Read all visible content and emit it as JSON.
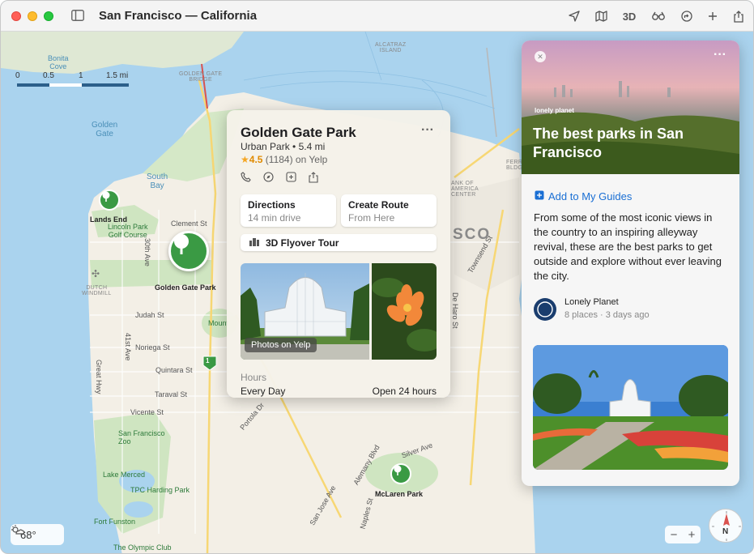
{
  "window": {
    "title": "San Francisco — California"
  },
  "toolbar": {
    "three_d_label": "3D"
  },
  "map": {
    "scale": {
      "labels": [
        "0",
        "0.5",
        "1",
        "1.5 mi"
      ]
    },
    "labels": {
      "bonita_cove": "Bonita\nCove",
      "golden_gate_bridge": "GOLDEN GATE\nBRIDGE",
      "alcatraz": "ALCATRAZ\nISLAND",
      "golden_gate_water": "Golden\nGate",
      "south_bay": "South\nBay",
      "lands_end": "Lands End",
      "lincoln_park": "Lincoln Park\nGolf Course",
      "clement_st": "Clement St",
      "thirtieth_ave": "30th Ave",
      "dutch_windmill": "DUTCH\nWINDMILL",
      "golden_gate_park": "Golden Gate Park",
      "judah_st": "Judah St",
      "noriega_st": "Noriega St",
      "quintara_st": "Quintara St",
      "taraval_st": "Taraval St",
      "vicente_st": "Vicente St",
      "great_hwy": "Great Hwy",
      "forty_first_ave": "41st Ave",
      "sf_zoo": "San Francisco\nZoo",
      "lake_merced": "Lake Merced",
      "tpc_harding": "TPC Harding Park",
      "fort_funston": "Fort Funston",
      "olympic_club": "The Olympic Club",
      "mcLaren_park": "McLaren Park",
      "silver_ave": "Silver Ave",
      "alemany_blvd": "Alemany Blvd",
      "portola_dr": "Portola Dr",
      "san_jose_ave": "San Jose Ave",
      "naples_st": "Naples St",
      "de_haro_st": "De Haro St",
      "townsend_st": "Townsend St",
      "sco": "SCO",
      "bank_of_america": "ANK OF\nAMERICA\nCENTER",
      "ferry_bldg": "FERRY\nBLDG",
      "mount": "Mount",
      "route_one": "1"
    }
  },
  "weather": {
    "temp": "68°"
  },
  "place_card": {
    "title": "Golden Gate Park",
    "category": "Urban Park",
    "distance": "5.4 mi",
    "rating": "4.5",
    "reviews": "(1184) on Yelp",
    "directions_label": "Directions",
    "directions_sub": "14 min drive",
    "create_route_label": "Create Route",
    "create_route_sub": "From Here",
    "flyover_label": "3D Flyover Tour",
    "photos_tag": "Photos on Yelp",
    "hours_label": "Hours",
    "hours_days": "Every Day",
    "hours_time": "Open 24 hours"
  },
  "guide": {
    "brand": "lonely planet",
    "title": "The best parks in San Francisco",
    "add_label": "Add to My Guides",
    "description": "From some of the most iconic views in the country to an inspiring alleyway revival, these are the best parks to get outside and explore without ever leaving the city.",
    "author": "Lonely Planet",
    "meta": "8 places · 3 days ago"
  },
  "colors": {
    "accent": "#1a6fd4",
    "park_green": "#3a9a44",
    "water": "#aad3ee",
    "land": "#f3efe6"
  }
}
